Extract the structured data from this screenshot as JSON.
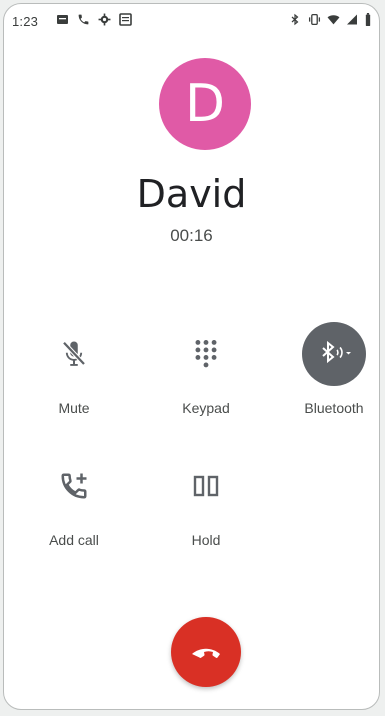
{
  "status_bar": {
    "time": "1:23",
    "left_icons": [
      "message-icon",
      "phone-icon",
      "settings-icon",
      "news-icon"
    ],
    "right_icons": [
      "bluetooth-icon",
      "vibrate-icon",
      "wifi-icon",
      "signal-icon",
      "battery-icon"
    ]
  },
  "caller": {
    "initial": "D",
    "avatar_color": "#e05aa6",
    "name": "David",
    "duration": "00:16"
  },
  "controls": {
    "mute": {
      "label": "Mute",
      "icon": "mic-off-icon",
      "active": false
    },
    "keypad": {
      "label": "Keypad",
      "icon": "dialpad-icon",
      "active": false
    },
    "bluetooth": {
      "label": "Bluetooth",
      "icon": "bluetooth-audio-icon",
      "active": true
    },
    "add_call": {
      "label": "Add call",
      "icon": "add-call-icon",
      "active": false
    },
    "hold": {
      "label": "Hold",
      "icon": "pause-icon",
      "active": false
    }
  },
  "end_call": {
    "icon": "call-end-icon",
    "color": "#d93025"
  }
}
